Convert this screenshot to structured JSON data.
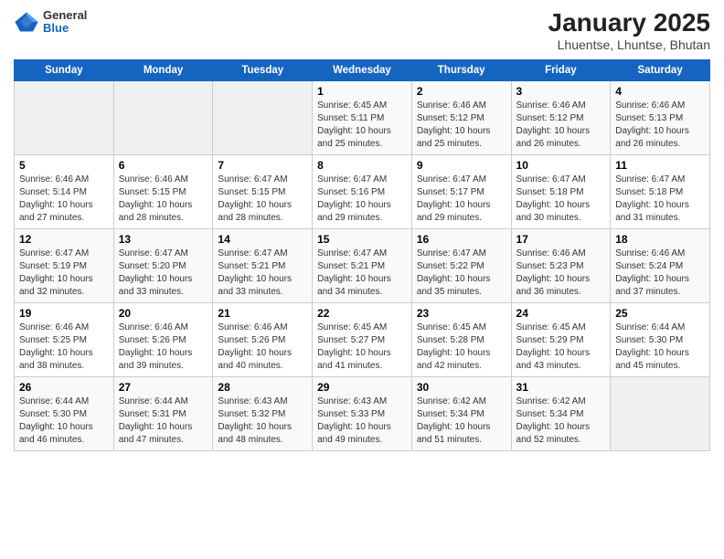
{
  "header": {
    "logo_general": "General",
    "logo_blue": "Blue",
    "title": "January 2025",
    "subtitle": "Lhuentse, Lhuntse, Bhutan"
  },
  "weekdays": [
    "Sunday",
    "Monday",
    "Tuesday",
    "Wednesday",
    "Thursday",
    "Friday",
    "Saturday"
  ],
  "weeks": [
    [
      {
        "day": "",
        "info": ""
      },
      {
        "day": "",
        "info": ""
      },
      {
        "day": "",
        "info": ""
      },
      {
        "day": "1",
        "info": "Sunrise: 6:45 AM\nSunset: 5:11 PM\nDaylight: 10 hours\nand 25 minutes."
      },
      {
        "day": "2",
        "info": "Sunrise: 6:46 AM\nSunset: 5:12 PM\nDaylight: 10 hours\nand 25 minutes."
      },
      {
        "day": "3",
        "info": "Sunrise: 6:46 AM\nSunset: 5:12 PM\nDaylight: 10 hours\nand 26 minutes."
      },
      {
        "day": "4",
        "info": "Sunrise: 6:46 AM\nSunset: 5:13 PM\nDaylight: 10 hours\nand 26 minutes."
      }
    ],
    [
      {
        "day": "5",
        "info": "Sunrise: 6:46 AM\nSunset: 5:14 PM\nDaylight: 10 hours\nand 27 minutes."
      },
      {
        "day": "6",
        "info": "Sunrise: 6:46 AM\nSunset: 5:15 PM\nDaylight: 10 hours\nand 28 minutes."
      },
      {
        "day": "7",
        "info": "Sunrise: 6:47 AM\nSunset: 5:15 PM\nDaylight: 10 hours\nand 28 minutes."
      },
      {
        "day": "8",
        "info": "Sunrise: 6:47 AM\nSunset: 5:16 PM\nDaylight: 10 hours\nand 29 minutes."
      },
      {
        "day": "9",
        "info": "Sunrise: 6:47 AM\nSunset: 5:17 PM\nDaylight: 10 hours\nand 29 minutes."
      },
      {
        "day": "10",
        "info": "Sunrise: 6:47 AM\nSunset: 5:18 PM\nDaylight: 10 hours\nand 30 minutes."
      },
      {
        "day": "11",
        "info": "Sunrise: 6:47 AM\nSunset: 5:18 PM\nDaylight: 10 hours\nand 31 minutes."
      }
    ],
    [
      {
        "day": "12",
        "info": "Sunrise: 6:47 AM\nSunset: 5:19 PM\nDaylight: 10 hours\nand 32 minutes."
      },
      {
        "day": "13",
        "info": "Sunrise: 6:47 AM\nSunset: 5:20 PM\nDaylight: 10 hours\nand 33 minutes."
      },
      {
        "day": "14",
        "info": "Sunrise: 6:47 AM\nSunset: 5:21 PM\nDaylight: 10 hours\nand 33 minutes."
      },
      {
        "day": "15",
        "info": "Sunrise: 6:47 AM\nSunset: 5:21 PM\nDaylight: 10 hours\nand 34 minutes."
      },
      {
        "day": "16",
        "info": "Sunrise: 6:47 AM\nSunset: 5:22 PM\nDaylight: 10 hours\nand 35 minutes."
      },
      {
        "day": "17",
        "info": "Sunrise: 6:46 AM\nSunset: 5:23 PM\nDaylight: 10 hours\nand 36 minutes."
      },
      {
        "day": "18",
        "info": "Sunrise: 6:46 AM\nSunset: 5:24 PM\nDaylight: 10 hours\nand 37 minutes."
      }
    ],
    [
      {
        "day": "19",
        "info": "Sunrise: 6:46 AM\nSunset: 5:25 PM\nDaylight: 10 hours\nand 38 minutes."
      },
      {
        "day": "20",
        "info": "Sunrise: 6:46 AM\nSunset: 5:26 PM\nDaylight: 10 hours\nand 39 minutes."
      },
      {
        "day": "21",
        "info": "Sunrise: 6:46 AM\nSunset: 5:26 PM\nDaylight: 10 hours\nand 40 minutes."
      },
      {
        "day": "22",
        "info": "Sunrise: 6:45 AM\nSunset: 5:27 PM\nDaylight: 10 hours\nand 41 minutes."
      },
      {
        "day": "23",
        "info": "Sunrise: 6:45 AM\nSunset: 5:28 PM\nDaylight: 10 hours\nand 42 minutes."
      },
      {
        "day": "24",
        "info": "Sunrise: 6:45 AM\nSunset: 5:29 PM\nDaylight: 10 hours\nand 43 minutes."
      },
      {
        "day": "25",
        "info": "Sunrise: 6:44 AM\nSunset: 5:30 PM\nDaylight: 10 hours\nand 45 minutes."
      }
    ],
    [
      {
        "day": "26",
        "info": "Sunrise: 6:44 AM\nSunset: 5:30 PM\nDaylight: 10 hours\nand 46 minutes."
      },
      {
        "day": "27",
        "info": "Sunrise: 6:44 AM\nSunset: 5:31 PM\nDaylight: 10 hours\nand 47 minutes."
      },
      {
        "day": "28",
        "info": "Sunrise: 6:43 AM\nSunset: 5:32 PM\nDaylight: 10 hours\nand 48 minutes."
      },
      {
        "day": "29",
        "info": "Sunrise: 6:43 AM\nSunset: 5:33 PM\nDaylight: 10 hours\nand 49 minutes."
      },
      {
        "day": "30",
        "info": "Sunrise: 6:42 AM\nSunset: 5:34 PM\nDaylight: 10 hours\nand 51 minutes."
      },
      {
        "day": "31",
        "info": "Sunrise: 6:42 AM\nSunset: 5:34 PM\nDaylight: 10 hours\nand 52 minutes."
      },
      {
        "day": "",
        "info": ""
      }
    ]
  ]
}
